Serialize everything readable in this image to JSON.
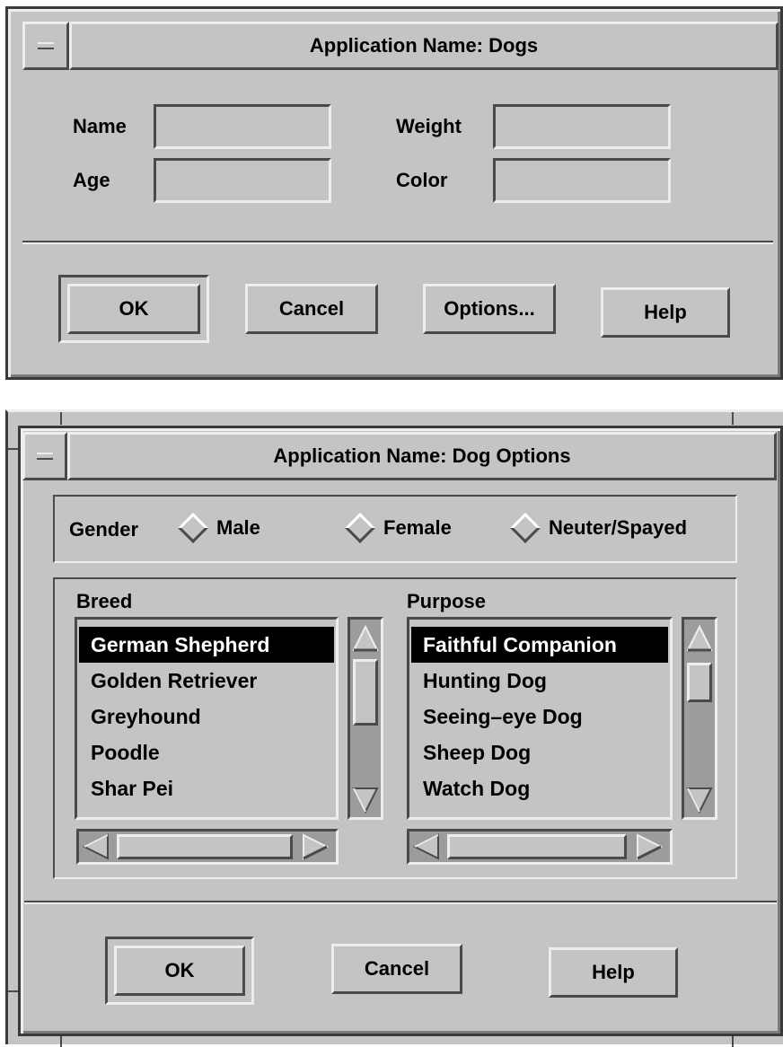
{
  "dogs_dialog": {
    "title": "Application Name: Dogs",
    "fields": {
      "name_label": "Name",
      "name_value": "",
      "age_label": "Age",
      "age_value": "",
      "weight_label": "Weight",
      "weight_value": "",
      "color_label": "Color",
      "color_value": ""
    },
    "buttons": {
      "ok": "OK",
      "cancel": "Cancel",
      "options": "Options...",
      "help": "Help"
    }
  },
  "options_dialog": {
    "title": "Application Name: Dog Options",
    "gender": {
      "label": "Gender",
      "options": [
        "Male",
        "Female",
        "Neuter/Spayed"
      ],
      "selected": null
    },
    "breed": {
      "label": "Breed",
      "items": [
        "German Shepherd",
        "Golden Retriever",
        "Greyhound",
        "Poodle",
        "Shar Pei"
      ],
      "selected": "German Shepherd"
    },
    "purpose": {
      "label": "Purpose",
      "items": [
        "Faithful Companion",
        "Hunting Dog",
        "Seeing–eye Dog",
        "Sheep Dog",
        "Watch Dog"
      ],
      "selected": "Faithful Companion"
    },
    "buttons": {
      "ok": "OK",
      "cancel": "Cancel",
      "help": "Help"
    }
  },
  "colors": {
    "face": "#c4c4c4",
    "highlight": "#ededed",
    "shadow": "#4a4a4a",
    "trough": "#9c9c9c",
    "selection": "#000000"
  },
  "icons": [
    "window-menu-icon",
    "radio-diamond-icon",
    "arrow-up-icon",
    "arrow-down-icon",
    "arrow-left-icon",
    "arrow-right-icon"
  ]
}
